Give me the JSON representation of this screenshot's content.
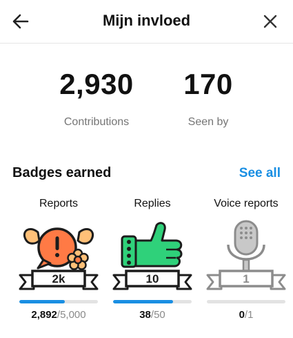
{
  "header": {
    "title": "Mijn invloed"
  },
  "stats": [
    {
      "value": "2,930",
      "label": "Contributions"
    },
    {
      "value": "170",
      "label": "Seen by"
    }
  ],
  "badges_section": {
    "title": "Badges earned",
    "see_all": "See all"
  },
  "badges": [
    {
      "name": "Reports",
      "level": "2k",
      "current": "2,892",
      "separator": "/",
      "total": "5,000",
      "progress": 0.578
    },
    {
      "name": "Replies",
      "level": "10",
      "current": "38",
      "separator": "/",
      "total": "50",
      "progress": 0.76
    },
    {
      "name": "Voice reports",
      "level": "1",
      "current": "0",
      "separator": "/",
      "total": "1",
      "progress": 0
    }
  ],
  "colors": {
    "accent": "#1a8fe3",
    "reports_badge": "#ff7a45",
    "replies_badge": "#2fd17a",
    "voice_badge": "#c8c8c8"
  }
}
